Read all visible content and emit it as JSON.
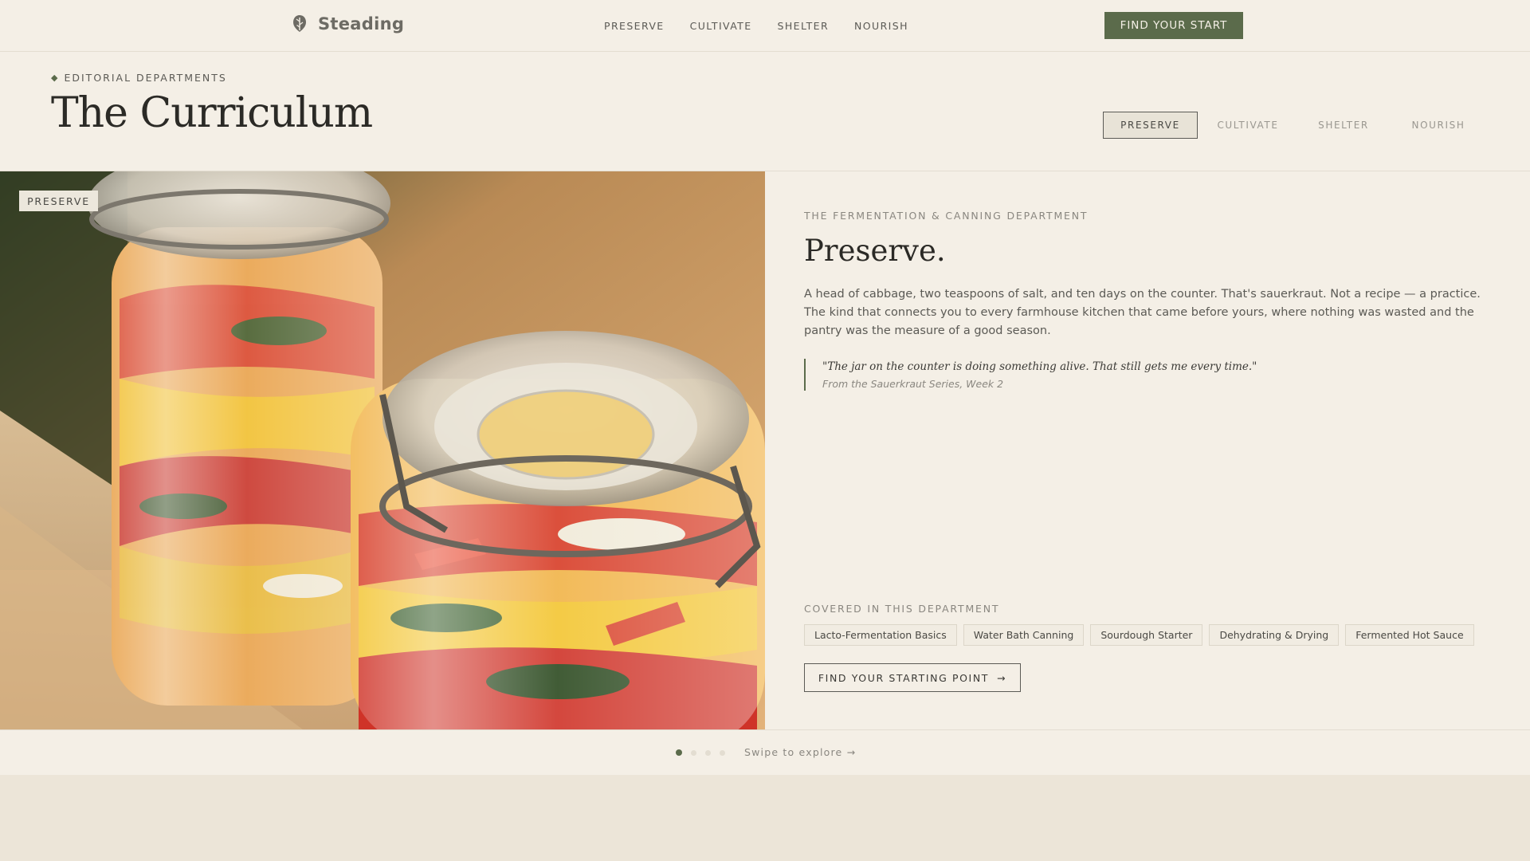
{
  "brand": {
    "name": "Steading",
    "icon": "acorn-leaf-icon"
  },
  "nav": {
    "links": [
      "PRESERVE",
      "CULTIVATE",
      "SHELTER",
      "NOURISH"
    ],
    "cta": "FIND YOUR START"
  },
  "header": {
    "eyebrow": "EDITORIAL DEPARTMENTS",
    "title": "The Curriculum",
    "tabs": [
      "PRESERVE",
      "CULTIVATE",
      "SHELTER",
      "NOURISH"
    ],
    "active_tab": "PRESERVE"
  },
  "photo": {
    "badge": "PRESERVE",
    "subject": "Two glass jars of pickled peppers and zucchini"
  },
  "department": {
    "eyebrow": "THE FERMENTATION & CANNING DEPARTMENT",
    "title": "Preserve.",
    "body": "A head of cabbage, two teaspoons of salt, and ten days on the counter. That's sauerkraut. Not a recipe — a practice. The kind that connects you to every farmhouse kitchen that came before yours, where nothing was wasted and the pantry was the measure of a good season.",
    "quote": "\"The jar on the counter is doing something alive. That still gets me every time.\"",
    "quote_source": "From the Sauerkraut Series, Week 2",
    "covered_label": "COVERED IN THIS DEPARTMENT",
    "topics": [
      "Lacto-Fermentation Basics",
      "Water Bath Canning",
      "Sourdough Starter",
      "Dehydrating & Drying",
      "Fermented Hot Sauce"
    ],
    "cta": "FIND YOUR STARTING POINT",
    "cta_arrow": "→"
  },
  "pager": {
    "total": 4,
    "active_index": 0,
    "hint": "Swipe to explore →"
  },
  "colors": {
    "accent": "#5b6b4b",
    "background": "#f4efe6",
    "text": "#2b2a26"
  }
}
